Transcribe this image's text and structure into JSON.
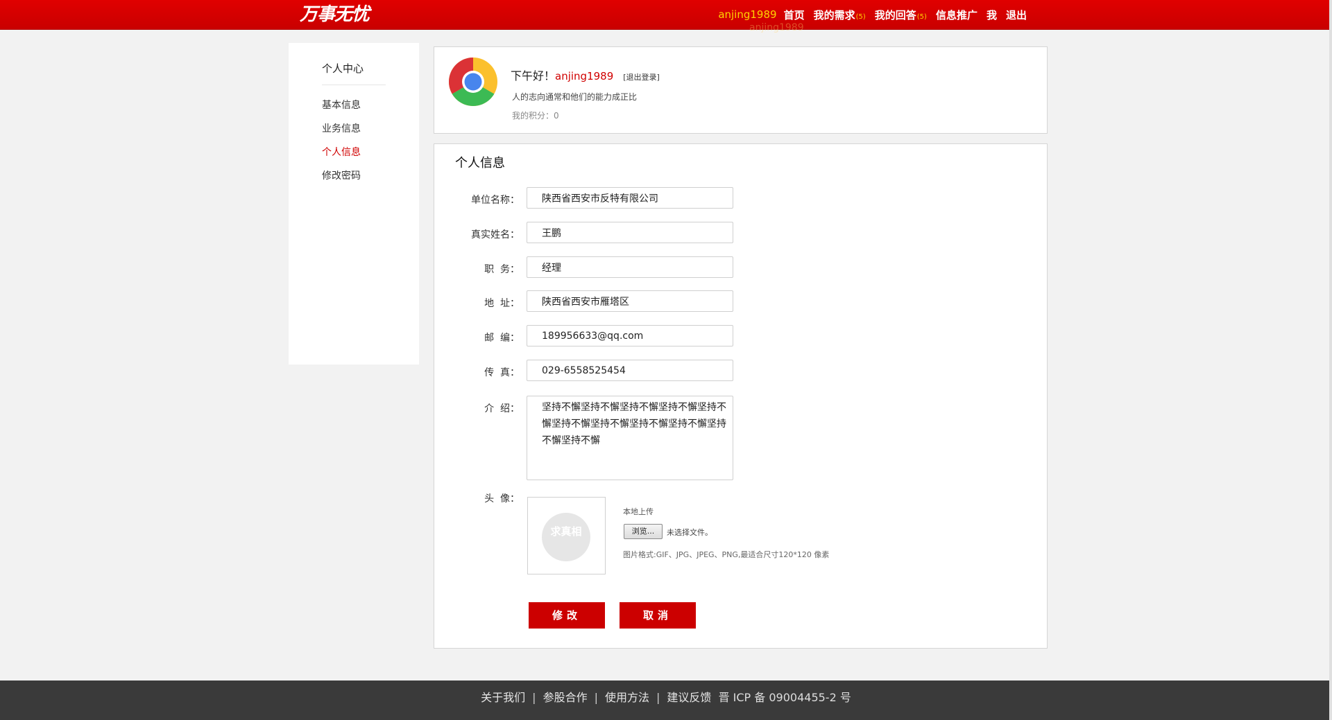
{
  "header": {
    "logo": "万事无忧",
    "username": "anjing1989",
    "nav": [
      {
        "label": "首页"
      },
      {
        "label": "我的需求",
        "count": "(5)"
      },
      {
        "label": "我的回答",
        "count": "(5)"
      },
      {
        "label": "信息推广"
      },
      {
        "label": "我"
      },
      {
        "label": "退出"
      }
    ],
    "ghost_text": "anjing1989"
  },
  "sidebar": {
    "title": "个人中心",
    "items": [
      "基本信息",
      "业务信息",
      "个人信息",
      "修改密码"
    ],
    "active": "个人信息"
  },
  "profile": {
    "greeting": "下午好！",
    "username": "anjing1989",
    "logout": "[退出登录]",
    "motto": "人的志向通常和他们的能力成正比",
    "score": "我的积分：0"
  },
  "info": {
    "heading": "个人信息",
    "fields": {
      "company": {
        "label": "单位名称：",
        "value": "陕西省西安市反特有限公司"
      },
      "name": {
        "label": "真实姓名：",
        "value": "王鹏"
      },
      "title": {
        "label": "职  务：",
        "value": "经理"
      },
      "address": {
        "label": "地  址：",
        "value": "陕西省西安市雁塔区"
      },
      "zip": {
        "label": "邮  编：",
        "value": "189956633@qq.com"
      },
      "fax": {
        "label": "传  真：",
        "value": "029-6558525454"
      },
      "intro": {
        "label": "介  绍：",
        "value": "坚持不懈坚持不懈坚持不懈坚持不懈坚持不懈坚持不懈坚持不懈坚持不懈坚持不懈坚持不懈坚持不懈"
      }
    },
    "avatar": {
      "label": "头  像：",
      "placeholder_text": "求真相",
      "upload_label": "本地上传",
      "browse_label": "浏览...",
      "no_file": "未选择文件。",
      "hint": "图片格式:GIF、JPG、JPEG、PNG,最适合尺寸120*120 像素"
    },
    "buttons": {
      "submit": "修改",
      "cancel": "取消"
    }
  },
  "footer": {
    "links": [
      "关于我们",
      "参股合作",
      "使用方法",
      "建议反馈"
    ],
    "icp": "晋 ICP 备 09004455-2 号"
  },
  "colors": {
    "brand_red": "#cc0000",
    "accent_yellow": "#ffd200"
  }
}
